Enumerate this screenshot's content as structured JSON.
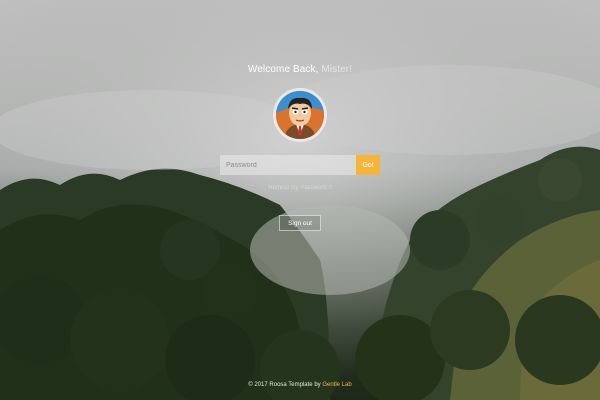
{
  "welcome": {
    "greeting": "Welcome Back,",
    "name": "Mister!"
  },
  "avatar": {
    "icon": "cartoon-man-avatar"
  },
  "login": {
    "password_placeholder": "Password",
    "go_label": "Go!"
  },
  "remind_link": "Remind my Password ?",
  "signout_label": "Sign out",
  "footer": {
    "text": "© 2017 Roosa Template by",
    "author": "Gentle Lab"
  },
  "colors": {
    "accent": "#f4b53a",
    "text": "#ffffff"
  }
}
